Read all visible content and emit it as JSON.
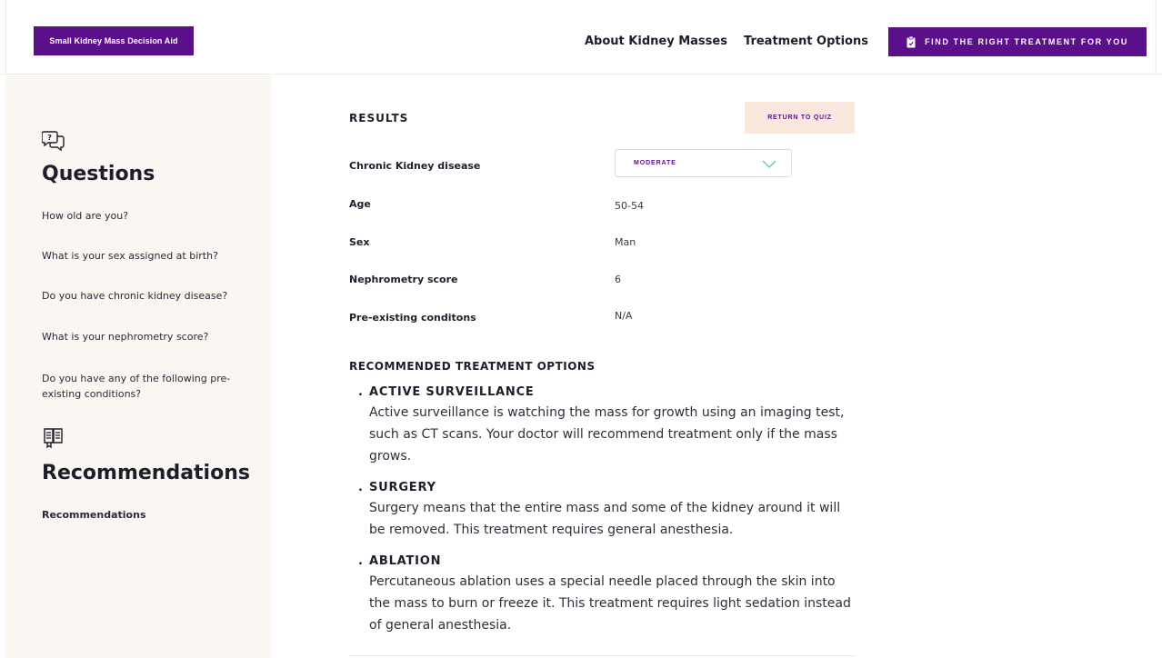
{
  "header": {
    "brand_label": "Small Kidney Mass Decision Aid",
    "nav": [
      {
        "label": "About Kidney Masses"
      },
      {
        "label": "Treatment Options"
      }
    ],
    "cta_label": "FIND THE RIGHT TREATMENT FOR YOU",
    "cta_icon": "clipboard-icon"
  },
  "sidebar": {
    "questions_heading": "Questions",
    "questions_icon": "chat-question-icon",
    "questions": [
      "How old are you?",
      "What is your sex assigned at birth?",
      "Do you have chronic kidney disease?",
      "What is your nephrometry score?",
      "Do you have any of the following pre-existing conditions?"
    ],
    "recommendations_heading": "Recommendations",
    "recommendations_icon": "book-list-icon",
    "recommendations_items": [
      "Recommendations"
    ]
  },
  "results": {
    "title": "RESULTS",
    "return_button": "RETURN TO QUIZ",
    "rows": [
      {
        "label": "Chronic Kidney disease",
        "value": "MODERATE"
      },
      {
        "label": "Age",
        "value": "50-54"
      },
      {
        "label": "Sex",
        "value": "Man"
      },
      {
        "label": "Nephrometry score",
        "value": "6"
      },
      {
        "label": "Pre-existing conditons",
        "value": "N/A"
      }
    ]
  },
  "recommended": {
    "title": "RECOMMENDED TREATMENT OPTIONS",
    "bullet": ".",
    "options": [
      {
        "name": "ACTIVE SURVEILLANCE",
        "description": "Active surveillance is watching the mass for growth using an imaging test, such as CT scans. Your doctor will recommend treatment only if the mass grows."
      },
      {
        "name": "SURGERY",
        "description": "Surgery means that the entire mass and some of the kidney around it will be removed. This treatment requires general anesthesia."
      },
      {
        "name": "ABLATION",
        "description": "Percutaneous ablation uses a special needle placed through the skin into the mass to burn or freeze it. This treatment requires light sedation instead of general anesthesia."
      }
    ]
  },
  "colors": {
    "brand_purple": "#5b0f8b",
    "sidebar_bg": "#faf7f3",
    "return_bg": "#fae8dc",
    "chevron_green": "#6fcf97"
  }
}
